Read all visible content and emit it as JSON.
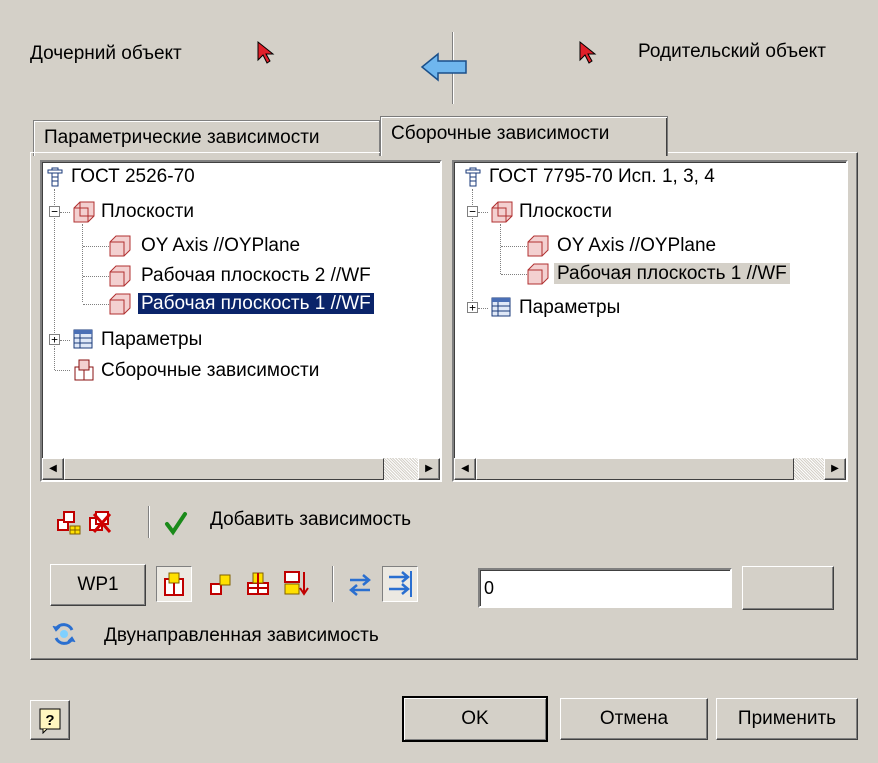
{
  "header": {
    "child_label": "Дочерний объект",
    "parent_label": "Родительский объект"
  },
  "tabs": [
    {
      "label": "Параметрические зависимости",
      "active": false
    },
    {
      "label": "Сборочные зависимости",
      "active": true
    }
  ],
  "left_tree": {
    "root": "ГОСТ 2526-70",
    "planes": "Плоскости",
    "plane_items": [
      "OY Axis //OYPlane",
      "Рабочая плоскость 2 //WF",
      "Рабочая плоскость 1 //WF"
    ],
    "selected_index": 2,
    "params": "Параметры",
    "assembly": "Сборочные зависимости"
  },
  "right_tree": {
    "root": "ГОСТ 7795-70 Исп. 1, 3, 4",
    "planes": "Плоскости",
    "plane_items": [
      "OY Axis //OYPlane",
      "Рабочая плоскость 1 //WF"
    ],
    "highlighted_index": 1,
    "params": "Параметры"
  },
  "toolbar": {
    "add_dependency_label": "Добавить зависимость",
    "wp_button": "WP1",
    "value_field": "0",
    "bidirectional_label": "Двунаправленная зависимость"
  },
  "footer": {
    "ok": "OK",
    "cancel": "Отмена",
    "apply": "Применить"
  },
  "colors": {
    "dialog_bg": "#d4d0c8",
    "selection": "#0a246a",
    "arrow_blue": "#3b8fd8",
    "cursor_red": "#e0202a"
  }
}
